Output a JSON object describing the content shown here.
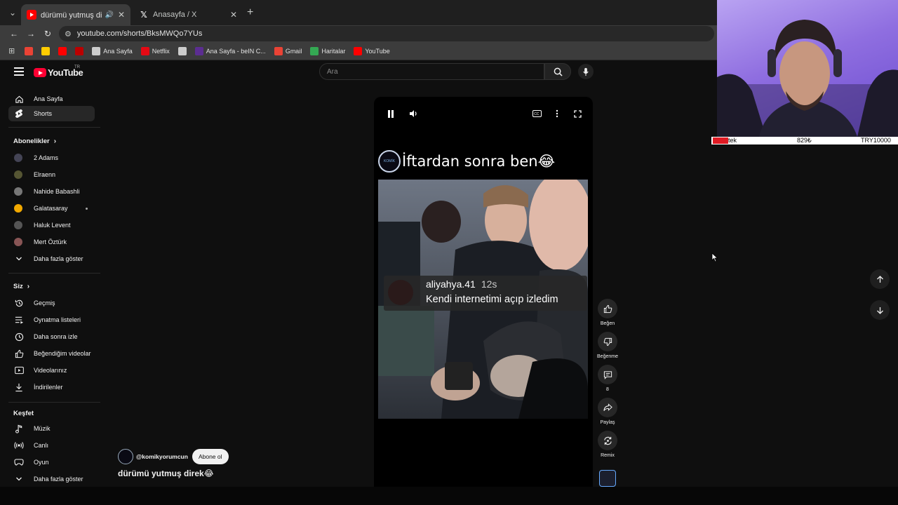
{
  "browser": {
    "tabs": [
      {
        "title": "dürümü yutmuş direk😂 - YouTube",
        "active": true
      },
      {
        "title": "Anasayfa / X",
        "active": false
      }
    ],
    "url": "youtube.com/shorts/BksMWQo7YUs",
    "bookmarks": [
      {
        "label": "",
        "icon": "gmail-icon",
        "color": "#ea4335"
      },
      {
        "label": "",
        "icon": "yandex-icon",
        "color": "#fc0"
      },
      {
        "label": "",
        "icon": "youtube-icon",
        "color": "#ff0000"
      },
      {
        "label": "",
        "icon": "pinterest-icon",
        "color": "#b00"
      },
      {
        "label": "Ana Sayfa",
        "icon": "globe-icon",
        "color": "#ccc"
      },
      {
        "label": "Netflix",
        "icon": "netflix-icon",
        "color": "#e50914"
      },
      {
        "label": "",
        "icon": "globe-icon",
        "color": "#ccc"
      },
      {
        "label": "Ana Sayfa - beIN C...",
        "icon": "bein-icon",
        "color": "#5b2d91"
      },
      {
        "label": "Gmail",
        "icon": "gmail-icon",
        "color": "#ea4335"
      },
      {
        "label": "Haritalar",
        "icon": "maps-icon",
        "color": "#34a853"
      },
      {
        "label": "YouTube",
        "icon": "youtube-icon",
        "color": "#ff0000"
      }
    ]
  },
  "masthead": {
    "logo_text": "YouTube",
    "country_code": "TR",
    "search_placeholder": "Ara"
  },
  "sidebar": {
    "main": [
      {
        "label": "Ana Sayfa",
        "icon": "home-icon"
      },
      {
        "label": "Shorts",
        "icon": "shorts-icon",
        "active": true
      }
    ],
    "subs_title": "Abonelikler",
    "subscriptions": [
      {
        "label": "2 Adams",
        "color": "#445"
      },
      {
        "label": "Elraenn",
        "color": "#553"
      },
      {
        "label": "Nahide Babashli",
        "color": "#777"
      },
      {
        "label": "Galatasaray",
        "color": "#f2a900",
        "dot": true
      },
      {
        "label": "Haluk Levent",
        "color": "#555"
      },
      {
        "label": "Mert Öztürk",
        "color": "#855"
      }
    ],
    "subs_more": "Daha fazla göster",
    "you_title": "Siz",
    "you": [
      {
        "label": "Geçmiş",
        "icon": "history-icon"
      },
      {
        "label": "Oynatma listeleri",
        "icon": "playlist-icon"
      },
      {
        "label": "Daha sonra izle",
        "icon": "clock-icon"
      },
      {
        "label": "Beğendiğim videolar",
        "icon": "thumbs-up-icon"
      },
      {
        "label": "Videolarınız",
        "icon": "video-icon"
      },
      {
        "label": "İndirilenler",
        "icon": "download-icon"
      }
    ],
    "explore_title": "Keşfet",
    "explore": [
      {
        "label": "Müzik",
        "icon": "music-icon"
      },
      {
        "label": "Canlı",
        "icon": "live-icon"
      },
      {
        "label": "Oyun",
        "icon": "gaming-icon"
      }
    ],
    "explore_more": "Daha fazla göster"
  },
  "short": {
    "caption": "İftardan sonra ben😂",
    "channel_logo_text": "KOMİK YORUMCUN",
    "comment_user": "aliyahya.41",
    "comment_time": "12s",
    "comment_text": "Kendi internetimi açıp izledim",
    "channel_handle": "@komikyorumcun",
    "subscribe_label": "Abone ol",
    "title": "dürümü yutmuş direk😂"
  },
  "actions": [
    {
      "label": "Beğen",
      "icon": "like-icon"
    },
    {
      "label": "Beğenme",
      "icon": "dislike-icon"
    },
    {
      "label": "8",
      "icon": "comment-icon"
    },
    {
      "label": "Paylaş",
      "icon": "share-icon"
    },
    {
      "label": "Remix",
      "icon": "remix-icon"
    }
  ],
  "ticker": {
    "left": "tek",
    "middle": "829₺",
    "right": "TRY10000"
  }
}
